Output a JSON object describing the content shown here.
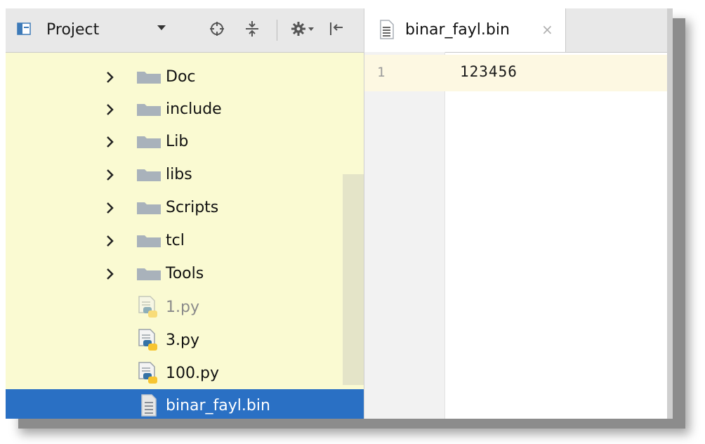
{
  "project_panel": {
    "title": "Project",
    "toolbar": {
      "icons": [
        "project-view-icon",
        "dropdown-arrow-icon",
        "locate-target-icon",
        "collapse-all-icon",
        "gear-icon",
        "hide-panel-icon"
      ]
    },
    "tree": [
      {
        "label": "Doc",
        "type": "folder",
        "expandable": true
      },
      {
        "label": "include",
        "type": "folder",
        "expandable": true
      },
      {
        "label": "Lib",
        "type": "folder",
        "expandable": true
      },
      {
        "label": "libs",
        "type": "folder",
        "expandable": true
      },
      {
        "label": "Scripts",
        "type": "folder",
        "expandable": true
      },
      {
        "label": "tcl",
        "type": "folder",
        "expandable": true
      },
      {
        "label": "Tools",
        "type": "folder",
        "expandable": true
      },
      {
        "label": "1.py",
        "type": "python-file",
        "dimmed": true
      },
      {
        "label": "3.py",
        "type": "python-file"
      },
      {
        "label": "100.py",
        "type": "python-file"
      },
      {
        "label": "binar_fayl.bin",
        "type": "text-file",
        "selected": true
      }
    ]
  },
  "editor": {
    "tab": {
      "label": "binar_fayl.bin",
      "close_glyph": "×"
    },
    "lines": [
      {
        "number": "1",
        "text": "123456"
      }
    ]
  },
  "colors": {
    "project_background": "#fafad2",
    "selection": "#2a70c4",
    "toolbar": "#e8e8e8",
    "current_line": "#fdf8e2",
    "gutter": "#f2f2f2",
    "folder": "#a9b2bb",
    "python_blue": "#3572a5",
    "python_yellow": "#f7c531"
  }
}
